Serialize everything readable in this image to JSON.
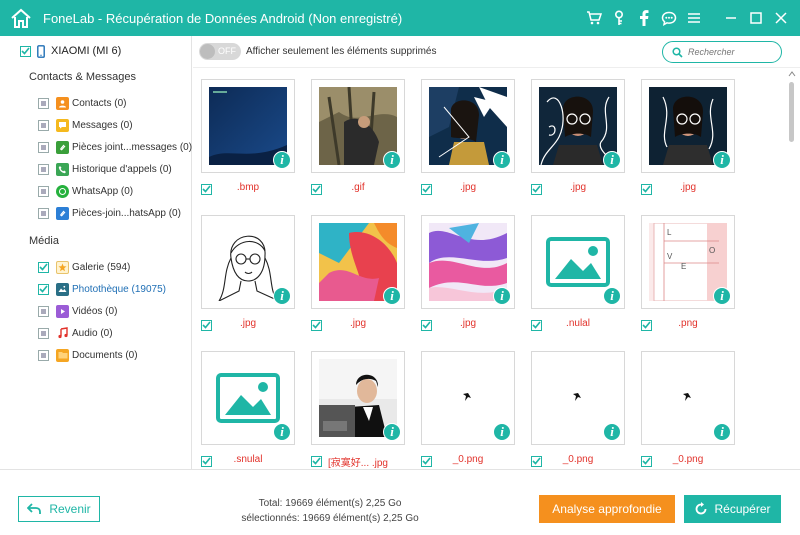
{
  "app": {
    "title": "FoneLab - Récupération de Données Android (Non enregistré)",
    "accent": "#1fb6a6",
    "orange": "#f5901e",
    "titlebar_icons": [
      "cart-icon",
      "key-icon",
      "facebook-icon",
      "chat-icon",
      "menu-icon",
      "minimize-icon",
      "maximize-icon",
      "close-icon"
    ]
  },
  "sidebar": {
    "device": "XIAOMI (MI 6)",
    "sections": [
      {
        "title": "Contacts & Messages",
        "items": [
          {
            "label": "Contacts (0)",
            "icon": "contacts-icon",
            "color": "#f5901e"
          },
          {
            "label": "Messages (0)",
            "icon": "messages-icon",
            "color": "#f5b91e"
          },
          {
            "label": "Pièces joint...messages (0)",
            "icon": "attachment-icon",
            "color": "#3a9f3a"
          },
          {
            "label": "Historique d'appels (0)",
            "icon": "call-log-icon",
            "color": "#3aa655"
          },
          {
            "label": "WhatsApp (0)",
            "icon": "whatsapp-icon",
            "color": "#25b13d"
          },
          {
            "label": "Pièces-join...hatsApp (0)",
            "icon": "whatsapp-attachment-icon",
            "color": "#2c7fd6"
          }
        ]
      },
      {
        "title": "Média",
        "items": [
          {
            "label": "Galerie (594)",
            "icon": "gallery-icon",
            "color": "#f5b91e"
          },
          {
            "label": "Photothèque (19075)",
            "icon": "photo-library-icon",
            "color": "#2a6f86"
          },
          {
            "label": "Vidéos (0)",
            "icon": "videos-icon",
            "color": "#9b5cd6"
          },
          {
            "label": "Audio (0)",
            "icon": "audio-icon",
            "color": "#e2322b"
          },
          {
            "label": "Documents (0)",
            "icon": "documents-icon",
            "color": "#f5a623"
          }
        ]
      }
    ]
  },
  "toolbar": {
    "toggle_label": "OFF",
    "caption": "Afficher seulement les éléments supprimés",
    "search_placeholder": "Rechercher"
  },
  "files": [
    {
      "name": ".bmp",
      "art": "dark-blue"
    },
    {
      "name": ".gif",
      "art": "photo-trees"
    },
    {
      "name": ".jpg",
      "art": "woman-collage"
    },
    {
      "name": ".jpg",
      "art": "woman-lines-dark"
    },
    {
      "name": ".jpg",
      "art": "woman-lines-dark2"
    },
    {
      "name": ".jpg",
      "art": "woman-sketch"
    },
    {
      "name": ".jpg",
      "art": "paint-red"
    },
    {
      "name": ".jpg",
      "art": "paint-purple"
    },
    {
      "name": ".nulal",
      "art": "placeholder"
    },
    {
      "name": ".png",
      "art": "doc-letters"
    },
    {
      "name": ".snulal",
      "art": "placeholder"
    },
    {
      "name": "[寂寞好... .jpg",
      "art": "album-cover"
    },
    {
      "name": "_0.png",
      "art": "tiny-star"
    },
    {
      "name": "_0.png",
      "art": "tiny-star"
    },
    {
      "name": "_0.png",
      "art": "tiny-star"
    }
  ],
  "footer": {
    "back_label": "Revenir",
    "total": "Total: 19669 élément(s) 2,25 Go",
    "selected": "sélectionnés: 19669 élément(s) 2,25 Go",
    "deep_scan_label": "Analyse approfondie",
    "recover_label": "Récupérer"
  }
}
